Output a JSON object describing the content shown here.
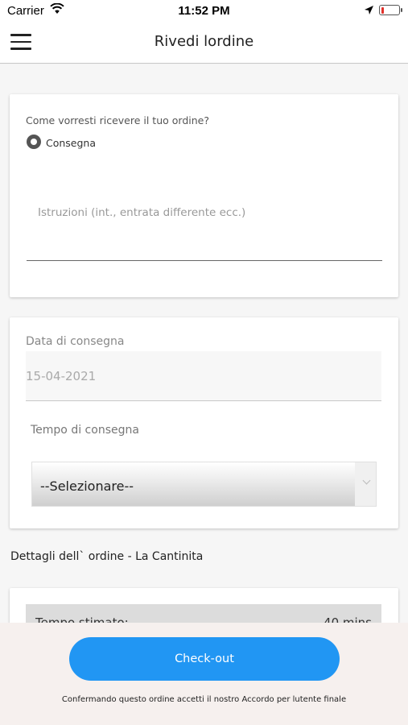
{
  "status_bar": {
    "carrier": "Carrier",
    "time": "11:52 PM",
    "wifi_icon": "wifi-icon",
    "location_icon": "location-arrow-icon",
    "battery_icon": "battery-low-icon"
  },
  "nav": {
    "menu_icon": "hamburger-menu-icon",
    "title": "Rivedi lordine"
  },
  "delivery_method": {
    "question": "Come vorresti ricevere il tuo ordine?",
    "option_label": "Consegna",
    "instructions_placeholder": "Istruzioni (int., entrata differente ecc.)"
  },
  "schedule": {
    "date_label": "Data di consegna",
    "date_value": "15-04-2021",
    "time_label": "Tempo di consegna",
    "time_selected": "--Selezionare--"
  },
  "order_details": {
    "title": "Dettagli dell` ordine - La Cantinita",
    "estimate_label": "Tempo stimato:",
    "estimate_value": "40 mins"
  },
  "footer": {
    "checkout_label": "Check-out",
    "terms_text": "Confermando questo ordine accetti il nostro Accordo per lutente finale"
  },
  "colors": {
    "accent": "#2196f3",
    "footer_bg": "#f6f0ee"
  }
}
